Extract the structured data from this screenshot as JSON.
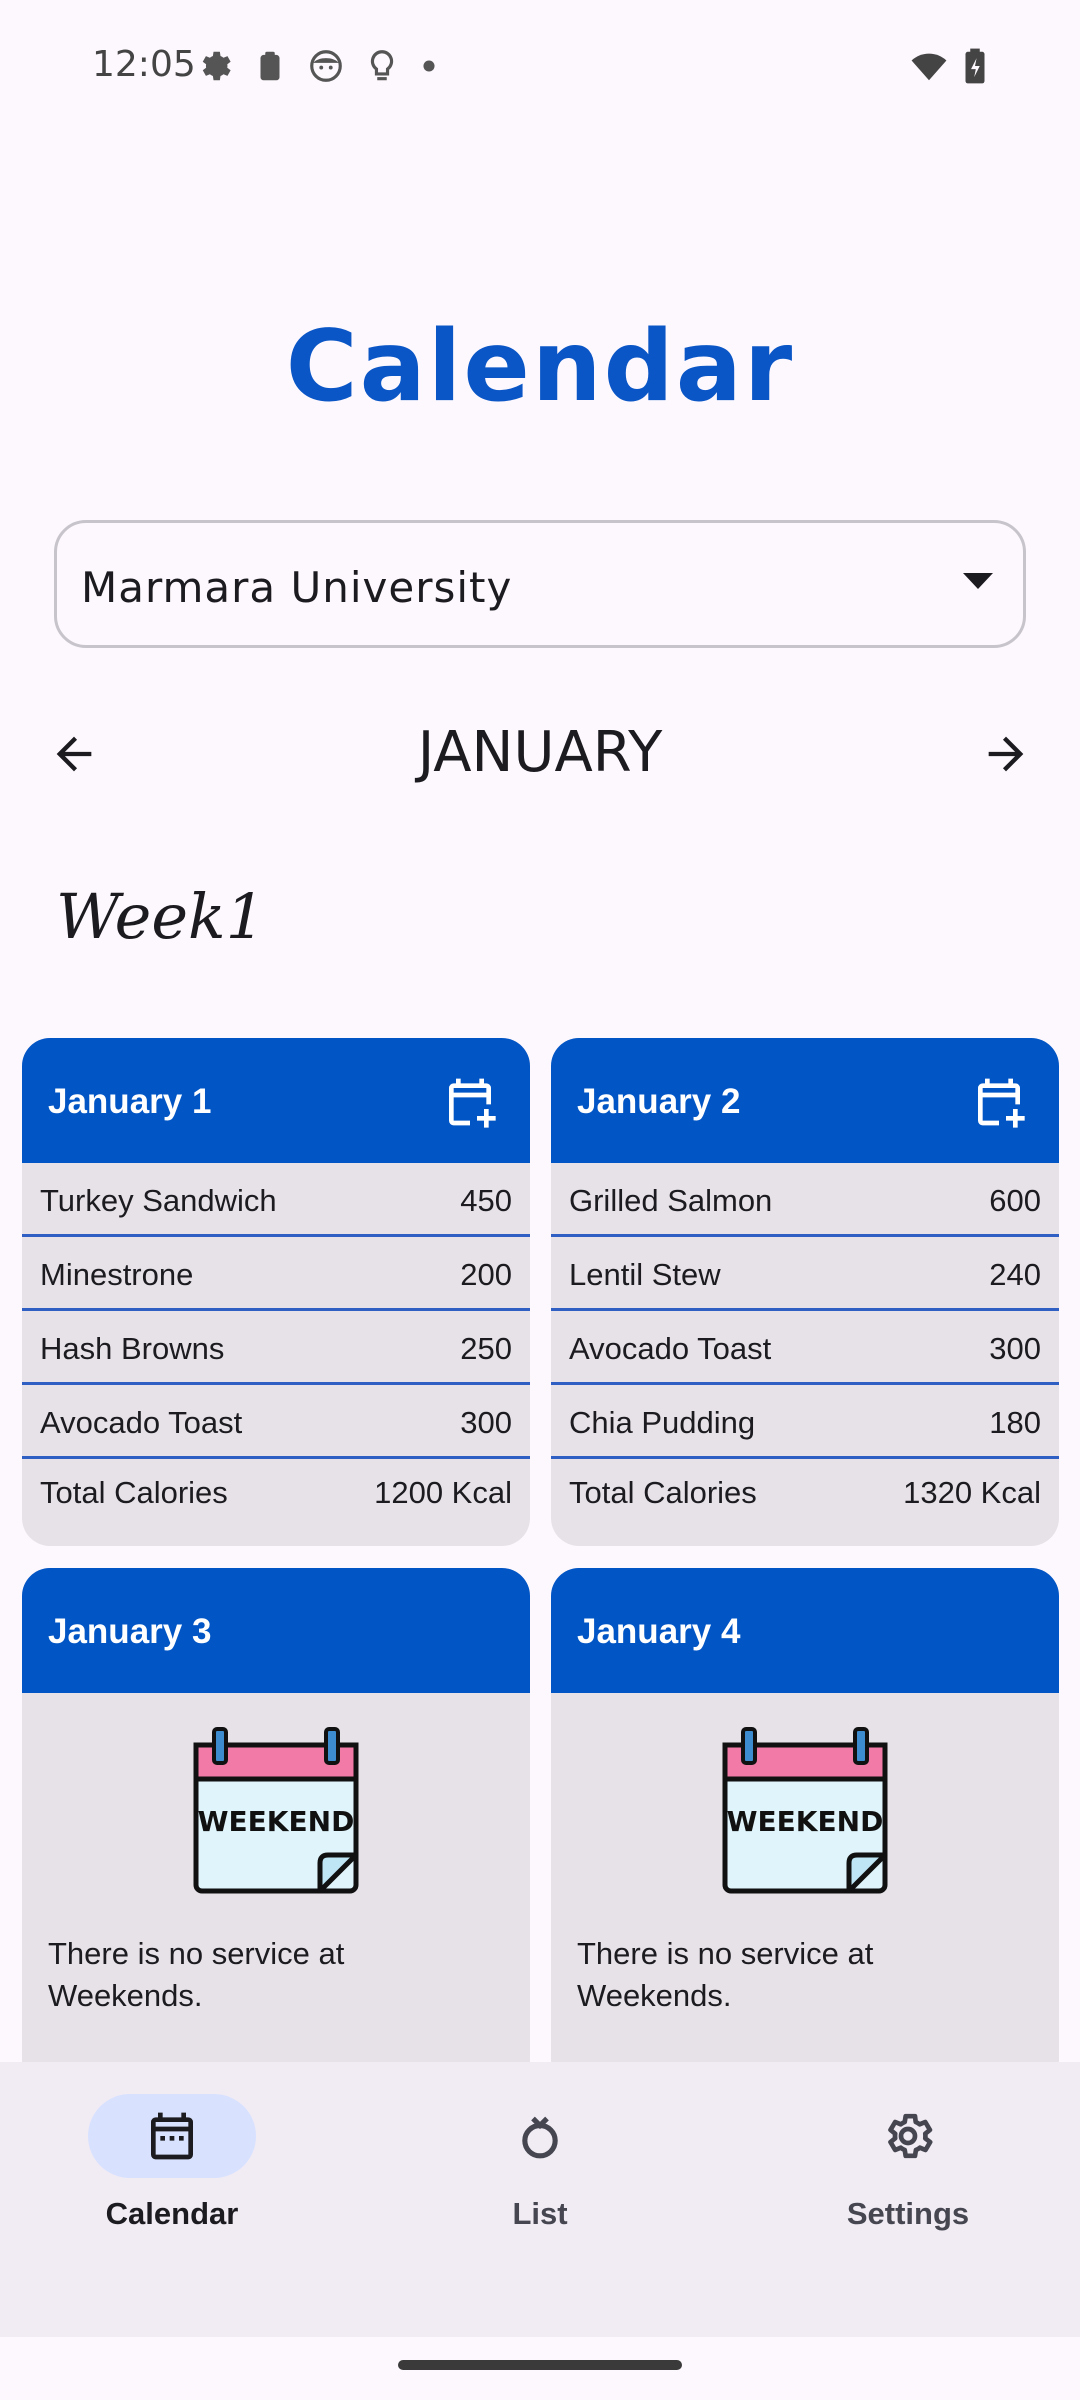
{
  "status_bar": {
    "time": "12:05",
    "left_icons": [
      "gear-icon",
      "clipboard-icon",
      "face-icon",
      "bulb-icon",
      "dot-icon"
    ],
    "right_icons": [
      "wifi-icon",
      "battery-icon"
    ]
  },
  "page": {
    "title": "Calendar"
  },
  "location_dropdown": {
    "value": "Marmara University"
  },
  "month_nav": {
    "month": "JANUARY"
  },
  "week_label": "Week1",
  "days": [
    {
      "date": "January 1",
      "meals": [
        {
          "name": "Turkey Sandwich",
          "calories": "450"
        },
        {
          "name": "Minestrone",
          "calories": "200"
        },
        {
          "name": "Hash Browns",
          "calories": "250"
        },
        {
          "name": "Avocado Toast",
          "calories": "300"
        }
      ],
      "total_label": "Total Calories",
      "total_value": "1200 Kcal"
    },
    {
      "date": "January 2",
      "meals": [
        {
          "name": "Grilled Salmon",
          "calories": "600"
        },
        {
          "name": "Lentil Stew",
          "calories": "240"
        },
        {
          "name": "Avocado Toast",
          "calories": "300"
        },
        {
          "name": "Chia Pudding",
          "calories": "180"
        }
      ],
      "total_label": "Total Calories",
      "total_value": "1320 Kcal"
    },
    {
      "date": "January 3",
      "weekend_badge": "WEEKEND",
      "message": "There is no service at Weekends."
    },
    {
      "date": "January 4",
      "weekend_badge": "WEEKEND",
      "message": "There is no service at Weekends."
    }
  ],
  "bottom_nav": {
    "items": [
      {
        "label": "Calendar",
        "icon": "calendar-icon",
        "active": true
      },
      {
        "label": "List",
        "icon": "ring-icon",
        "active": false
      },
      {
        "label": "Settings",
        "icon": "gear-icon",
        "active": false
      }
    ]
  },
  "colors": {
    "accent": "#0a56c6",
    "card_header": "#0255c5",
    "card_body": "#e7e2e8",
    "nav_background": "#f1ebf4",
    "nav_active_pill": "#d8e2ff"
  }
}
